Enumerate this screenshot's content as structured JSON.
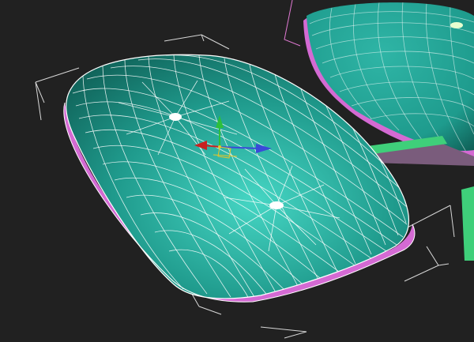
{
  "viewport": {
    "background": "#212121"
  },
  "scene": {
    "selected_object": {
      "type": "cushion",
      "colors": {
        "surface": "#1f9a8c",
        "surface_highlight": "#46d6c4",
        "surface_shadow": "#0f5e55",
        "wireframe": "#ffffff",
        "rim": "#d46ad3"
      }
    },
    "background_object": {
      "type": "chair-seat",
      "colors": {
        "surface": "#1e9b8d",
        "surface_shadow": "#0f5e55",
        "selection_bracket": "#e079d2",
        "base_leg": "#3fcf7a",
        "leg_shadow": "#7a5c7c"
      }
    },
    "bounding_box_color": "#d8d8d8"
  },
  "gizmo": {
    "type": "move-transform-gizmo",
    "axes": [
      {
        "axis": "x",
        "color": "#3a4ad8"
      },
      {
        "axis": "y",
        "color": "#2dbf3c"
      },
      {
        "axis": "z",
        "color": "#c92121"
      }
    ],
    "center_color": "#e5c52a"
  }
}
